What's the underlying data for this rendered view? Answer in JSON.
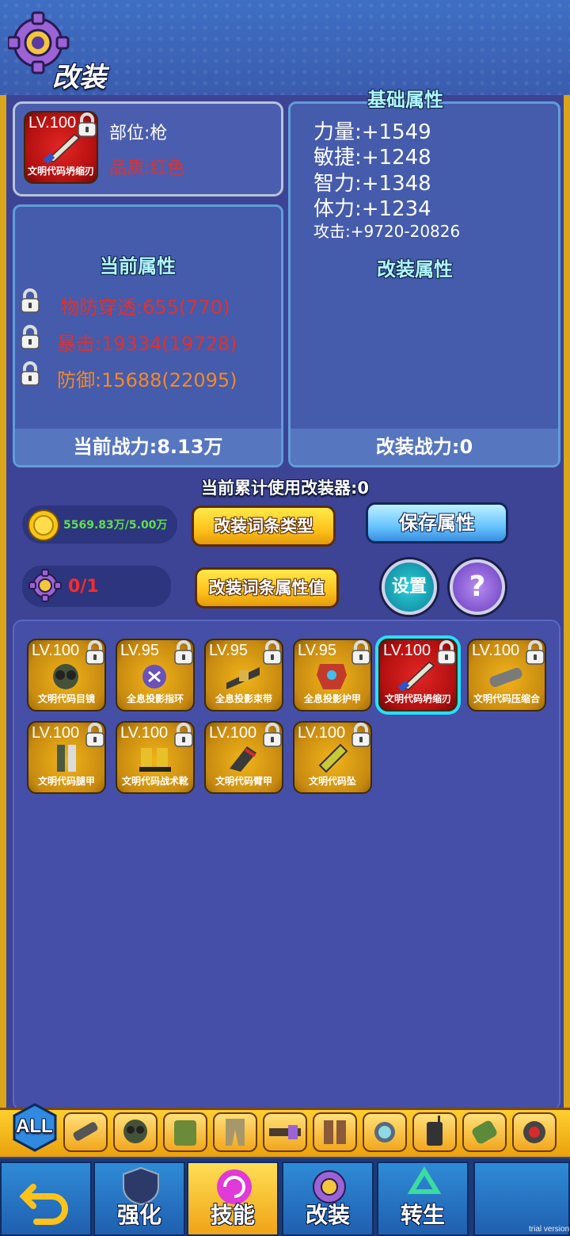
{
  "header": {
    "title": "改装",
    "icon": "gear-icon"
  },
  "selected_item": {
    "level": "LV.100",
    "name": "文明代码坍缩刃",
    "slot_label": "部位:枪",
    "quality_label": "品质:红色"
  },
  "base_attributes": {
    "title": "基础属性",
    "lines": [
      "力量:+1549",
      "敏捷:+1248",
      "智力:+1348",
      "体力:+1234"
    ],
    "attack": "攻击:+9720-20826"
  },
  "current_attributes": {
    "title": "当前属性",
    "lines": [
      {
        "text": "物防穿透:655(770)",
        "color": "#e4302a"
      },
      {
        "text": "暴击:19334(19728)",
        "color": "#e4302a"
      },
      {
        "text": "防御:15688(22095)",
        "color": "#ef8a2a"
      }
    ],
    "power": "当前战力:8.13万"
  },
  "mod_attributes": {
    "title": "改装属性",
    "power": "改装战力:0"
  },
  "usage_text": "当前累计使用改装器:0",
  "resources": {
    "coins": "5569.83万/5.00万",
    "modifiers": "0/1"
  },
  "buttons": {
    "mod_type": "改装词条类型",
    "mod_value": "改装词条属性值",
    "save": "保存属性",
    "settings": "设置",
    "help": "?"
  },
  "inventory": [
    {
      "level": "LV.100",
      "name": "文明代码目镜"
    },
    {
      "level": "LV.95",
      "name": "全息投影指环"
    },
    {
      "level": "LV.95",
      "name": "全息投影束带"
    },
    {
      "level": "LV.95",
      "name": "全息投影护甲"
    },
    {
      "level": "LV.100",
      "name": "文明代码坍缩刃",
      "selected": true
    },
    {
      "level": "LV.100",
      "name": "文明代码压缩合"
    },
    {
      "level": "LV.100",
      "name": "文明代码腿甲"
    },
    {
      "level": "LV.100",
      "name": "文明代码战术靴"
    },
    {
      "level": "LV.100",
      "name": "文明代码臂甲"
    },
    {
      "level": "LV.100",
      "name": "文明代码坠"
    }
  ],
  "filter": {
    "all_label": "ALL"
  },
  "nav": {
    "enhance": "强化",
    "skill": "技能",
    "modify": "改装",
    "rebirth": "转生"
  },
  "watermark": "trial version",
  "colors": {
    "accent_yellow": "#ffc21a",
    "panel_border": "#5f9ed8",
    "selected_glow": "#26e0ff"
  }
}
